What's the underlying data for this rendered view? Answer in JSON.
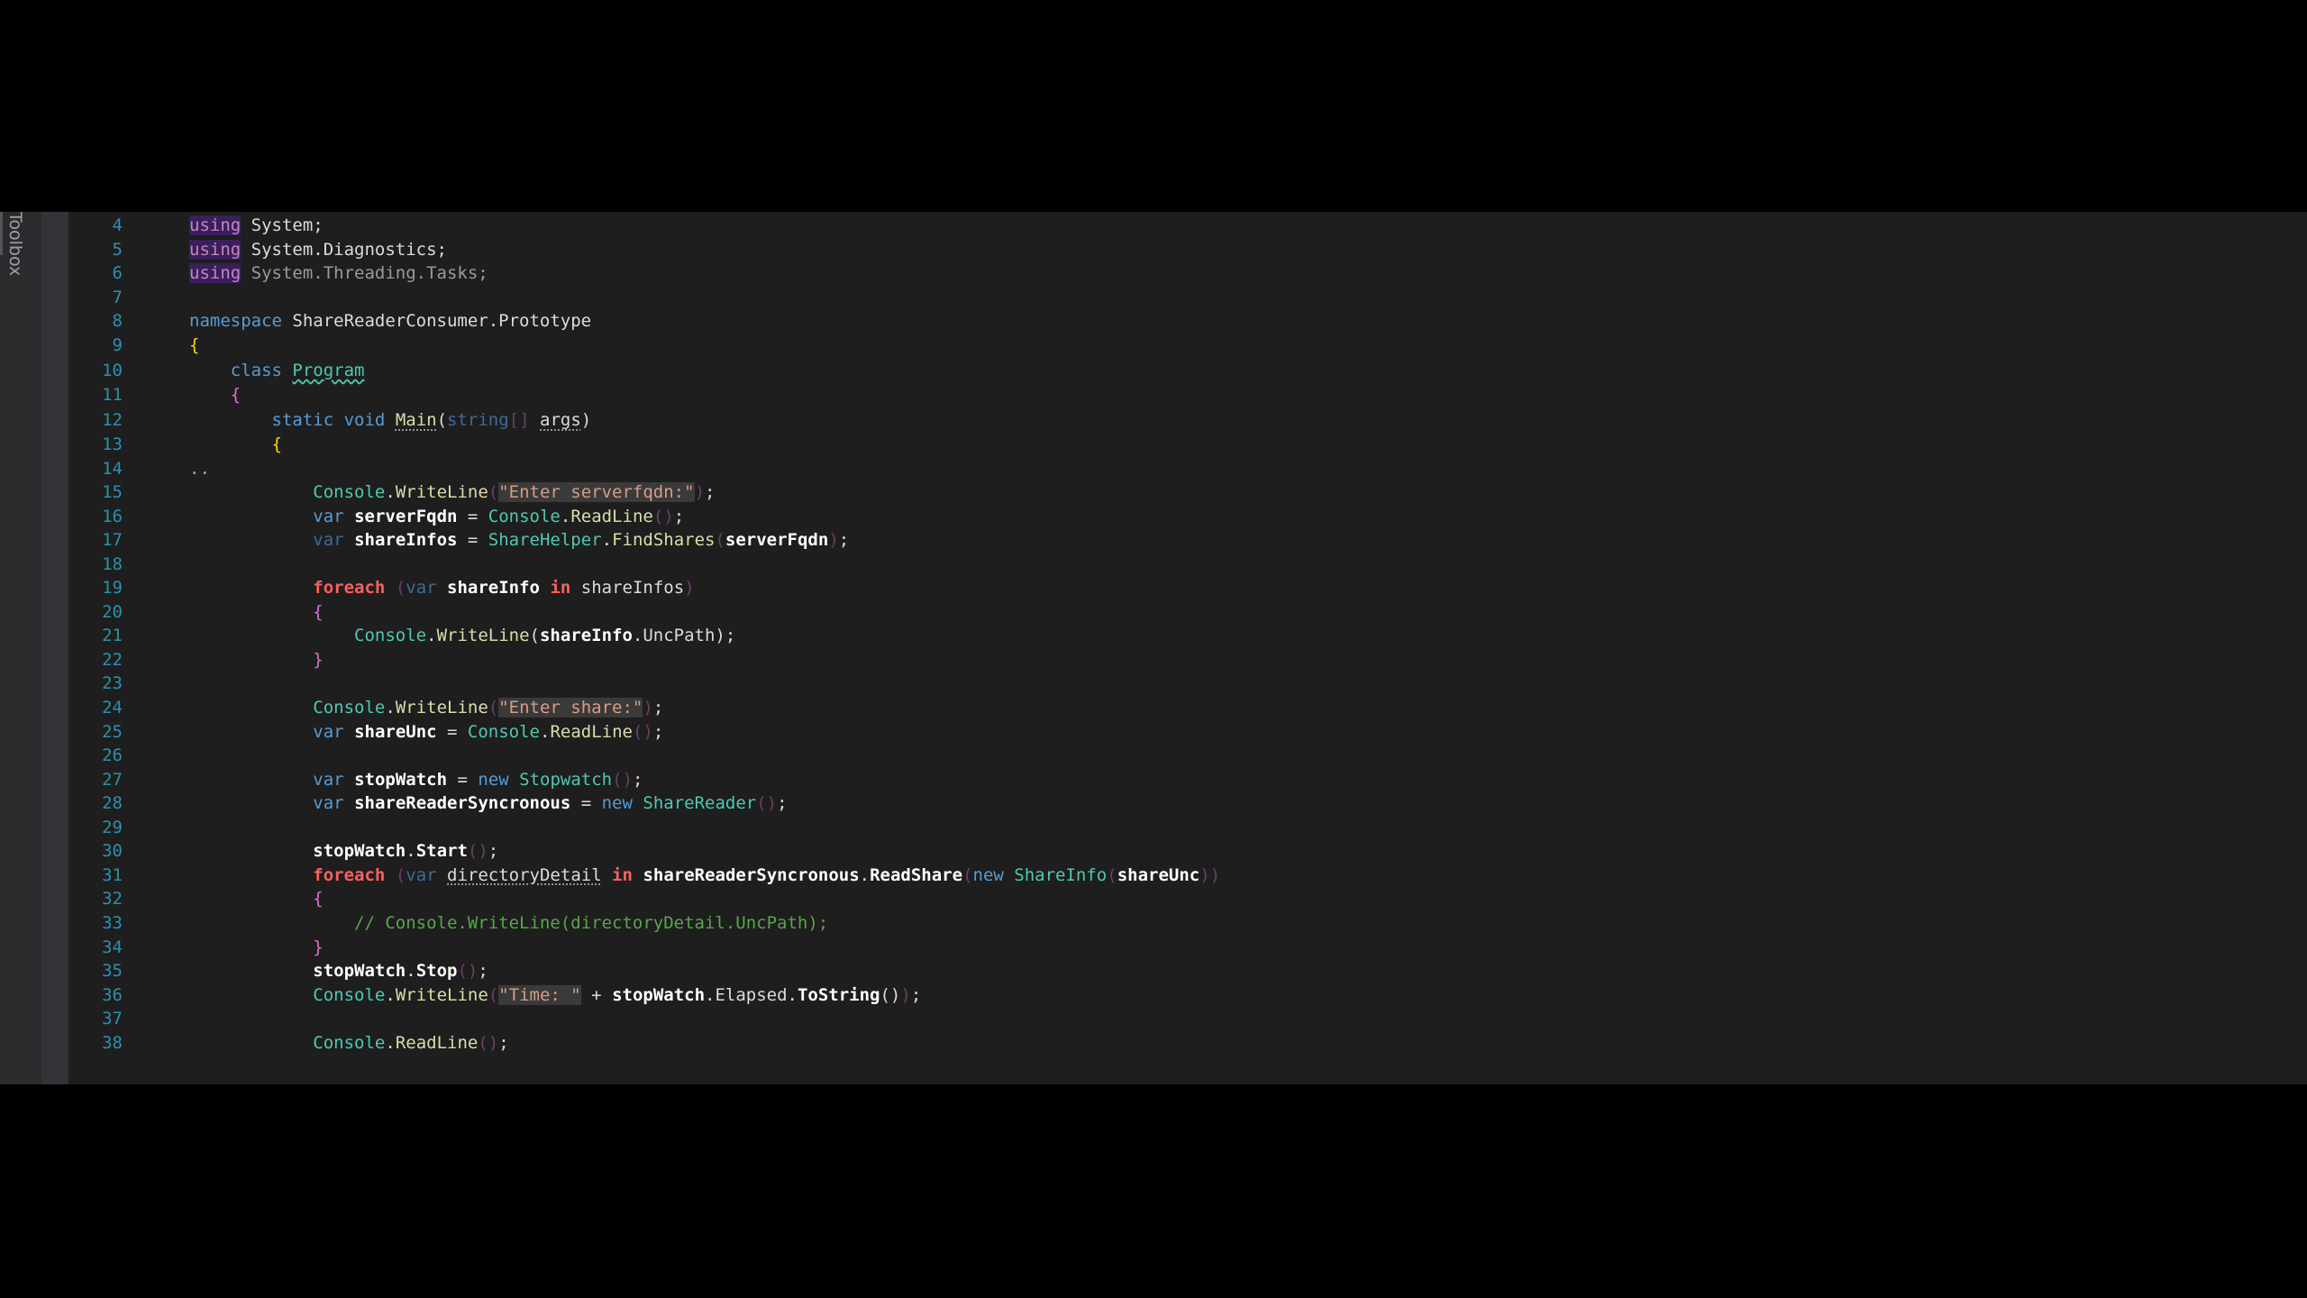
{
  "toolbox": {
    "label": "Toolbox"
  },
  "lines": [
    {
      "n": "4",
      "tokens": [
        [
          "using",
          "using"
        ],
        [
          "plain",
          " System;"
        ]
      ]
    },
    {
      "n": "5",
      "tokens": [
        [
          "using",
          "using"
        ],
        [
          "plain",
          " System.Diagnostics;"
        ]
      ]
    },
    {
      "n": "6",
      "tokens": [
        [
          "using",
          "using"
        ],
        [
          "dim",
          " System.Threading.Tasks;"
        ]
      ]
    },
    {
      "n": "7",
      "tokens": []
    },
    {
      "n": "8",
      "tokens": [
        [
          "kw",
          "namespace"
        ],
        [
          "plain",
          " ShareReaderConsumer.Prototype"
        ]
      ]
    },
    {
      "n": "9",
      "tokens": [
        [
          "brace1",
          "{"
        ]
      ]
    },
    {
      "n": "10",
      "tokens": [
        [
          "plain",
          "    "
        ],
        [
          "kw",
          "class"
        ],
        [
          "plain",
          " "
        ],
        [
          "type squiggle",
          "Program"
        ]
      ]
    },
    {
      "n": "11",
      "tokens": [
        [
          "plain",
          "    "
        ],
        [
          "brace2",
          "{"
        ]
      ]
    },
    {
      "n": "12",
      "tokens": [
        [
          "plain",
          "        "
        ],
        [
          "kw",
          "static"
        ],
        [
          "plain",
          " "
        ],
        [
          "kw",
          "void"
        ],
        [
          "plain",
          " "
        ],
        [
          "method dotted",
          "Main"
        ],
        [
          "plain",
          "("
        ],
        [
          "kwdim",
          "string"
        ],
        [
          "dimparen",
          "[]"
        ],
        [
          "plain",
          " "
        ],
        [
          "plain dotted",
          "args"
        ],
        [
          "plain",
          ")"
        ]
      ]
    },
    {
      "n": "13",
      "tokens": [
        [
          "plain",
          "        "
        ],
        [
          "brace1",
          "{"
        ]
      ]
    },
    {
      "n": "14",
      "tokens": [],
      "marker": ".."
    },
    {
      "n": "15",
      "tokens": [
        [
          "plain",
          "            "
        ],
        [
          "type",
          "Console"
        ],
        [
          "plain",
          "."
        ],
        [
          "method",
          "WriteLine"
        ],
        [
          "dimparen",
          "("
        ],
        [
          "str",
          "\"Enter serverfqdn:\""
        ],
        [
          "dimparen",
          ")"
        ],
        [
          "plain",
          ";"
        ]
      ]
    },
    {
      "n": "16",
      "tokens": [
        [
          "plain",
          "            "
        ],
        [
          "kw",
          "var"
        ],
        [
          "plain",
          " "
        ],
        [
          "var",
          "serverFqdn"
        ],
        [
          "plain",
          " = "
        ],
        [
          "type",
          "Console"
        ],
        [
          "plain",
          "."
        ],
        [
          "method",
          "ReadLine"
        ],
        [
          "dimparen",
          "()"
        ],
        [
          "plain",
          ";"
        ]
      ]
    },
    {
      "n": "17",
      "tokens": [
        [
          "plain",
          "            "
        ],
        [
          "kwdim",
          "var"
        ],
        [
          "plain",
          " "
        ],
        [
          "var",
          "shareInfos"
        ],
        [
          "plain",
          " = "
        ],
        [
          "type",
          "ShareHelper"
        ],
        [
          "plain",
          "."
        ],
        [
          "method",
          "FindShares"
        ],
        [
          "dimparen",
          "("
        ],
        [
          "var",
          "serverFqdn"
        ],
        [
          "dimparen",
          ")"
        ],
        [
          "plain",
          ";"
        ]
      ]
    },
    {
      "n": "18",
      "tokens": []
    },
    {
      "n": "19",
      "tokens": [
        [
          "plain",
          "            "
        ],
        [
          "ctrl",
          "foreach"
        ],
        [
          "plain",
          " "
        ],
        [
          "dimparen",
          "("
        ],
        [
          "kwdim",
          "var"
        ],
        [
          "plain",
          " "
        ],
        [
          "var",
          "shareInfo"
        ],
        [
          "plain",
          " "
        ],
        [
          "ctrl",
          "in"
        ],
        [
          "plain",
          " "
        ],
        [
          "plain",
          "shareInfos"
        ],
        [
          "dimparen",
          ")"
        ]
      ]
    },
    {
      "n": "20",
      "tokens": [
        [
          "plain",
          "            "
        ],
        [
          "brace2",
          "{"
        ]
      ]
    },
    {
      "n": "21",
      "tokens": [
        [
          "plain",
          "                "
        ],
        [
          "type",
          "Console"
        ],
        [
          "plain",
          "."
        ],
        [
          "method",
          "WriteLine"
        ],
        [
          "plain",
          "("
        ],
        [
          "var",
          "shareInfo"
        ],
        [
          "plain",
          ".UncPath);"
        ]
      ]
    },
    {
      "n": "22",
      "tokens": [
        [
          "plain",
          "            "
        ],
        [
          "brace2",
          "}"
        ]
      ]
    },
    {
      "n": "23",
      "tokens": []
    },
    {
      "n": "24",
      "tokens": [
        [
          "plain",
          "            "
        ],
        [
          "type",
          "Console"
        ],
        [
          "plain",
          "."
        ],
        [
          "method",
          "WriteLine"
        ],
        [
          "dimparen",
          "("
        ],
        [
          "str",
          "\"Enter share:\""
        ],
        [
          "dimparen",
          ")"
        ],
        [
          "plain",
          ";"
        ]
      ]
    },
    {
      "n": "25",
      "tokens": [
        [
          "plain",
          "            "
        ],
        [
          "kw",
          "var"
        ],
        [
          "plain",
          " "
        ],
        [
          "var",
          "shareUnc"
        ],
        [
          "plain",
          " = "
        ],
        [
          "type",
          "Console"
        ],
        [
          "plain",
          "."
        ],
        [
          "method",
          "ReadLine"
        ],
        [
          "dimparen",
          "()"
        ],
        [
          "plain",
          ";"
        ]
      ]
    },
    {
      "n": "26",
      "tokens": []
    },
    {
      "n": "27",
      "tokens": [
        [
          "plain",
          "            "
        ],
        [
          "kw",
          "var"
        ],
        [
          "plain",
          " "
        ],
        [
          "var",
          "stopWatch"
        ],
        [
          "plain",
          " = "
        ],
        [
          "kw",
          "new"
        ],
        [
          "plain",
          " "
        ],
        [
          "type",
          "Stopwatch"
        ],
        [
          "dimparen",
          "()"
        ],
        [
          "plain",
          ";"
        ]
      ]
    },
    {
      "n": "28",
      "tokens": [
        [
          "plain",
          "            "
        ],
        [
          "kw",
          "var"
        ],
        [
          "plain",
          " "
        ],
        [
          "var",
          "shareReaderSyncronous"
        ],
        [
          "plain",
          " = "
        ],
        [
          "kw",
          "new"
        ],
        [
          "plain",
          " "
        ],
        [
          "type",
          "ShareReader"
        ],
        [
          "dimparen",
          "()"
        ],
        [
          "plain",
          ";"
        ]
      ]
    },
    {
      "n": "29",
      "tokens": []
    },
    {
      "n": "30",
      "tokens": [
        [
          "plain",
          "            "
        ],
        [
          "var",
          "stopWatch"
        ],
        [
          "plain",
          "."
        ],
        [
          "var",
          "Start"
        ],
        [
          "dimparen",
          "()"
        ],
        [
          "plain",
          ";"
        ]
      ]
    },
    {
      "n": "31",
      "tokens": [
        [
          "plain",
          "            "
        ],
        [
          "ctrl",
          "foreach"
        ],
        [
          "plain",
          " "
        ],
        [
          "dimparen",
          "("
        ],
        [
          "kwdim",
          "var"
        ],
        [
          "plain",
          " "
        ],
        [
          "plain dotted",
          "directoryDetail"
        ],
        [
          "plain",
          " "
        ],
        [
          "ctrl",
          "in"
        ],
        [
          "plain",
          " "
        ],
        [
          "var",
          "shareReaderSyncronous"
        ],
        [
          "plain",
          "."
        ],
        [
          "var",
          "ReadShare"
        ],
        [
          "dimparen",
          "("
        ],
        [
          "kw",
          "new"
        ],
        [
          "plain",
          " "
        ],
        [
          "type",
          "ShareInfo"
        ],
        [
          "dimparen",
          "("
        ],
        [
          "var",
          "shareUnc"
        ],
        [
          "dimparen",
          "))"
        ]
      ]
    },
    {
      "n": "32",
      "tokens": [
        [
          "plain",
          "            "
        ],
        [
          "brace2",
          "{"
        ]
      ]
    },
    {
      "n": "33",
      "tokens": [
        [
          "plain",
          "                "
        ],
        [
          "cmt",
          "// Console.WriteLine(directoryDetail.UncPath);"
        ]
      ]
    },
    {
      "n": "34",
      "tokens": [
        [
          "plain",
          "            "
        ],
        [
          "brace2",
          "}"
        ]
      ]
    },
    {
      "n": "35",
      "tokens": [
        [
          "plain",
          "            "
        ],
        [
          "var",
          "stopWatch"
        ],
        [
          "plain",
          "."
        ],
        [
          "var",
          "Stop"
        ],
        [
          "dimparen",
          "()"
        ],
        [
          "plain",
          ";"
        ]
      ]
    },
    {
      "n": "36",
      "tokens": [
        [
          "plain",
          "            "
        ],
        [
          "type",
          "Console"
        ],
        [
          "plain",
          "."
        ],
        [
          "method",
          "WriteLine"
        ],
        [
          "dimparen",
          "("
        ],
        [
          "str",
          "\"Time: \""
        ],
        [
          "plain",
          " + "
        ],
        [
          "var",
          "stopWatch"
        ],
        [
          "plain",
          ".Elapsed."
        ],
        [
          "var",
          "ToString"
        ],
        [
          "plain",
          "()"
        ],
        [
          "dimparen",
          ")"
        ],
        [
          "plain",
          ";"
        ]
      ]
    },
    {
      "n": "37",
      "tokens": []
    },
    {
      "n": "38",
      "tokens": [
        [
          "plain",
          "            "
        ],
        [
          "type",
          "Console"
        ],
        [
          "plain",
          "."
        ],
        [
          "method",
          "ReadLine"
        ],
        [
          "dimparen",
          "()"
        ],
        [
          "plain",
          ";"
        ]
      ]
    }
  ]
}
